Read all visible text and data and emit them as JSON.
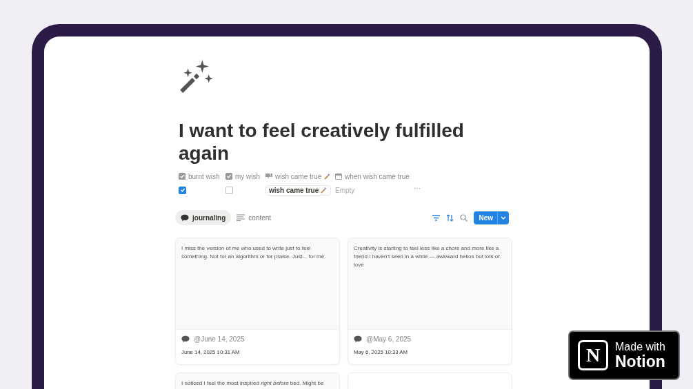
{
  "title": "I want to feel creatively fulfilled again",
  "properties": [
    {
      "kind": "checkbox",
      "label": "burnt wish",
      "checked": true
    },
    {
      "kind": "checkbox",
      "label": "my wish",
      "checked": false
    },
    {
      "kind": "select",
      "label": "wish came true",
      "value": "wish came true"
    },
    {
      "kind": "date",
      "label": "when wish came true",
      "value": "Empty"
    }
  ],
  "more": "···",
  "views": [
    {
      "kind": "bubble",
      "label": "journaling",
      "selected": true
    },
    {
      "kind": "lines",
      "label": "content",
      "selected": false
    }
  ],
  "new_button": "New",
  "cards": [
    {
      "kind": "entry",
      "text": "I miss the version of me who used to write just to feel something. Not for an algorithm or for praise. Just... for me.",
      "mention": "@June 14, 2025",
      "created": "June 14, 2025 10:31 AM"
    },
    {
      "kind": "entry",
      "text": "Creativity is starting to feel less like a chore and more like a friend I haven't seen in a while — awkward hellos but lots of love",
      "mention": "@May 6, 2025",
      "created": "May 6, 2025 10:33 AM"
    },
    {
      "kind": "entry",
      "text": "I noticed I feel the most inspired *right before* bed. Might be"
    },
    {
      "kind": "blank"
    }
  ],
  "badge": {
    "logo": "N",
    "line1": "Made with",
    "line2": "Notion"
  }
}
